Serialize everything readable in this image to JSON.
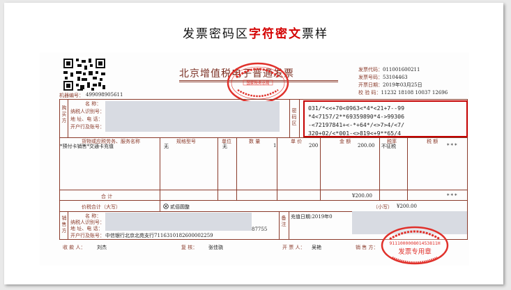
{
  "heading": {
    "prefix": "发票密码区",
    "highlight": "字符密文",
    "suffix": "票样"
  },
  "invoice": {
    "title": "北京增值税电子普通发票",
    "machine_no_label": "机器编号：",
    "machine_no": "499098905611",
    "meta": {
      "code_label": "发票代码：",
      "code": "011001600211",
      "number_label": "发票号码：",
      "number": "53104463",
      "date_label": "开票日期：",
      "date": "2019年03月25日",
      "check_label": "校 验 码：",
      "check": "11232 18108 10037 12696"
    },
    "buyer": {
      "section_label": "购买方",
      "name_label": "名  称：",
      "taxid_label": "纳税人识别号：",
      "address_label": "地 址、电 话：",
      "bank_label": "开户行及账号："
    },
    "cipher_label": "密码区",
    "cipher_lines": [
      "031/*<<+70<0963<*4*<21+7--99",
      "*4<7157/2**69359890*4->99306",
      "-<72197841+<-*+64*/<>7>4/<7/",
      "320+02/<*001-<>819<+9**65/4"
    ],
    "columns": {
      "item": "货物或应税劳务、服务名称",
      "spec": "规格型号",
      "unit": "单位",
      "qty": "数  量",
      "price": "单  价",
      "amount": "金  额",
      "rate": "税率",
      "tax": "税  额"
    },
    "row": {
      "item": "*预付卡销售*交通卡充值",
      "spec": "无",
      "unit": "无",
      "qty": "1",
      "price": "200",
      "amount": "200.00",
      "rate": "不征税",
      "tax": "***"
    },
    "total_label": "合          计",
    "total_amount": "¥200.00",
    "total_tax": "***",
    "grand_label": "价税合计（大写）",
    "grand_words": "贰佰圆整",
    "grand_small_label": "（小写）",
    "grand_small": "¥200.00",
    "seller": {
      "section_label": "销售方",
      "name_label": "名  称：",
      "taxid_label": "纳税人识别号：",
      "address_label": "地 址、电 话：",
      "address_tail": "87755",
      "bank_label": "开户行及账号：",
      "bank": "中信银行北京北苑支行7116310182600002259"
    },
    "remark_label": "备注",
    "remark": "充值日期:2019年0",
    "footer": {
      "payee_label": "收 款 人：",
      "payee": "刘杰",
      "reviewer_label": "复 核：",
      "reviewer": "张佳骁",
      "drawer_label": "开 票 人：",
      "drawer": "吴艳",
      "seller_label": "销 售 方："
    },
    "seal_center_text": "国家税务总局",
    "seal_seller_number": "911100000801453811H",
    "seal_seller_title": "发票专用章"
  },
  "colors": {
    "frame": "#8a3a2a",
    "cipher_border": "#c40000",
    "seal": "#e0302a"
  }
}
